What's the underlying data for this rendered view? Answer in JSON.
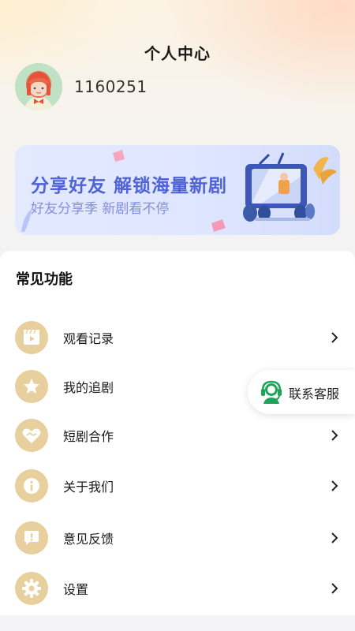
{
  "header": {
    "title": "个人中心"
  },
  "profile": {
    "avatar_icon": "girl-avatar-icon",
    "user_id": "1160251"
  },
  "banner": {
    "title": "分享好友 解锁海量新剧",
    "subtitle": "好友分享季 新剧看不停",
    "art_icon": "tv-illustration-icon"
  },
  "section": {
    "title": "常见功能"
  },
  "menu": [
    {
      "label": "观看记录",
      "icon": "video-history-icon"
    },
    {
      "label": "我的追剧",
      "icon": "star-icon"
    },
    {
      "label": "短剧合作",
      "icon": "handshake-heart-icon"
    },
    {
      "label": "关于我们",
      "icon": "info-icon"
    },
    {
      "label": "意见反馈",
      "icon": "feedback-icon"
    },
    {
      "label": "设置",
      "icon": "gear-icon"
    }
  ],
  "customer_service": {
    "label": "联系客服",
    "icon": "headset-icon"
  },
  "colors": {
    "icon_bg": "#e8cf9e",
    "banner_title": "#4f63d8",
    "banner_subtitle": "#8390d9",
    "service_green": "#1fa35a"
  }
}
